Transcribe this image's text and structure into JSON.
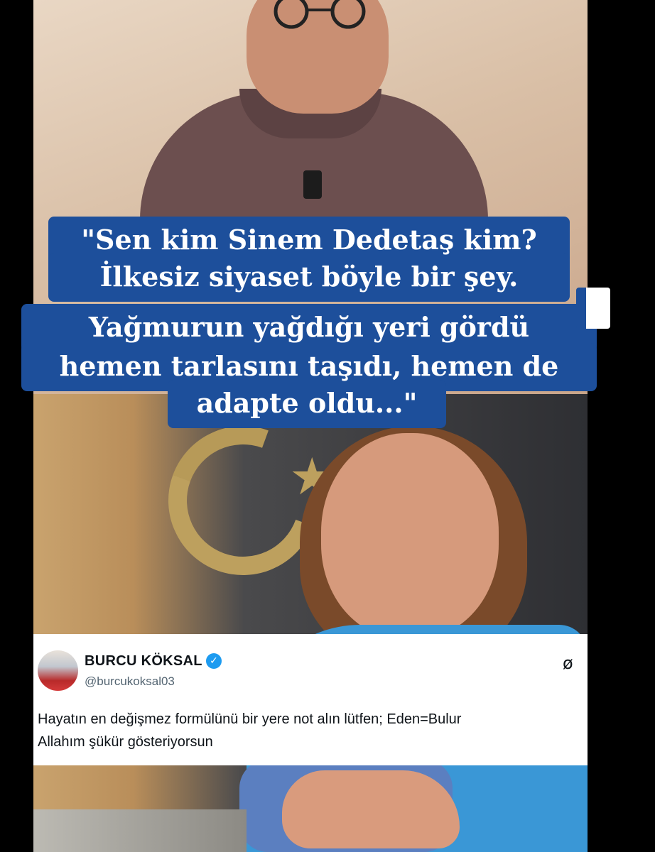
{
  "quote": {
    "line1": "\"Sen kim Sinem Dedetaş kim?",
    "line2": "İlkesiz siyaset böyle bir şey.",
    "line3": "Yağmurun yağdığı yeri gördü",
    "line4": "hemen tarlasını taşıdı, hemen de",
    "line5": "adapte oldu...\""
  },
  "tweet": {
    "name": "BURCU KÖKSAL",
    "handle": "@burcukoksal03",
    "text_line1": "Hayatın en değişmez formülünü bir yere not alın lütfen; Eden=Bulur",
    "text_line2": "Allahım şükür gösteriyorsun",
    "verified_icon": "verified-badge-icon",
    "x_icon": "x-logo-icon"
  },
  "colors": {
    "quote_bg": "#1d4f9b",
    "verified": "#1d9bf0"
  }
}
